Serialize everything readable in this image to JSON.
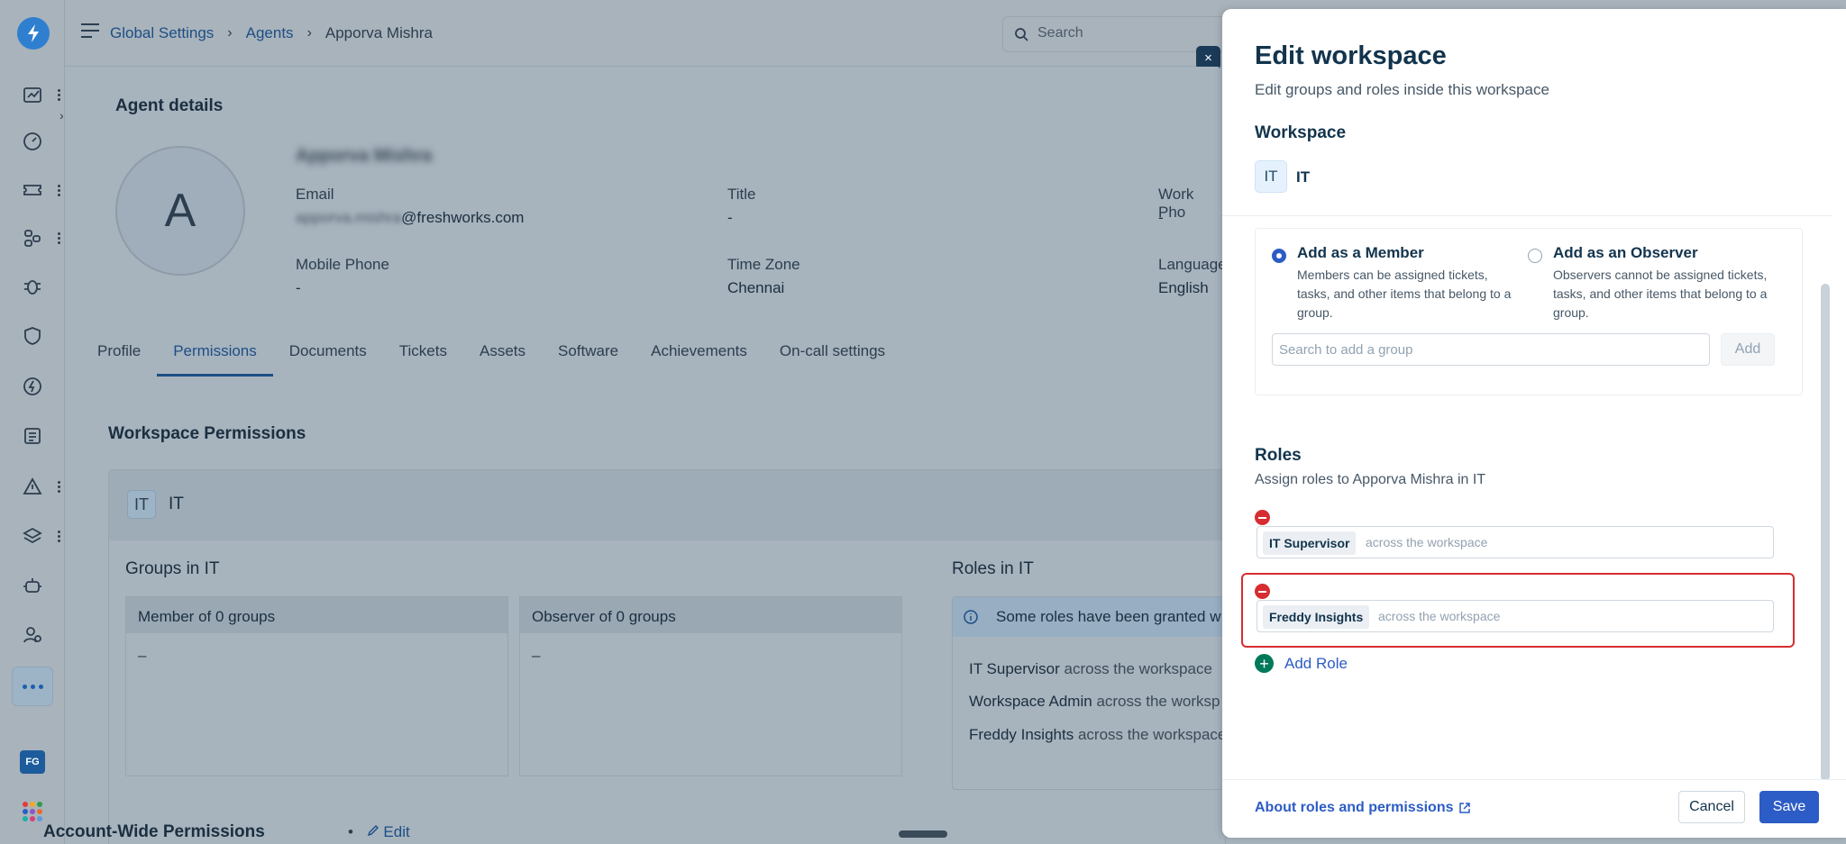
{
  "breadcrumb": {
    "items": [
      "Global Settings",
      "Agents"
    ],
    "current": "Apporva Mishra"
  },
  "search": {
    "placeholder": "Search"
  },
  "rail": {
    "user_initials": "FG",
    "apps_colors": [
      "#e33c3c",
      "#f5a623",
      "#2c9c4a",
      "#2c5cc5",
      "#8b54c7",
      "#e86d2e",
      "#1bb0a8",
      "#d8407a",
      "#5a9bd8"
    ]
  },
  "agent": {
    "section_title": "Agent details",
    "avatar_letter": "A",
    "name": "Apporva Mishra",
    "fields": {
      "email_label": "Email",
      "email_user": "apporva.mishra",
      "email_domain": "@freshworks.com",
      "title_label": "Title",
      "title_value": "-",
      "work_phone_label": "Work Pho",
      "work_phone_value": "-",
      "mobile_label": "Mobile Phone",
      "mobile_value": "-",
      "timezone_label": "Time Zone",
      "timezone_value": "Chennai",
      "language_label": "Language",
      "language_value": "English"
    }
  },
  "tabs": [
    "Profile",
    "Permissions",
    "Documents",
    "Tickets",
    "Assets",
    "Software",
    "Achievements",
    "On-call settings"
  ],
  "workspace_permissions": {
    "title": "Workspace Permissions",
    "badge": "IT",
    "name": "IT",
    "groups_title": "Groups in IT",
    "member_header": "Member of 0 groups",
    "member_value": "–",
    "observer_header": "Observer of 0 groups",
    "observer_value": "–",
    "roles_title": "Roles in IT",
    "roles_info": "Some roles have been granted w",
    "roles": [
      {
        "name": "IT Supervisor",
        "scope": "across the workspace"
      },
      {
        "name": "Workspace Admin",
        "scope": "across the worksp"
      },
      {
        "name": "Freddy Insights",
        "scope": "across the workspace"
      }
    ]
  },
  "account_wide": {
    "title": "Account-Wide Permissions",
    "edit": "Edit"
  },
  "drawer": {
    "title": "Edit workspace",
    "subtitle": "Edit groups and roles inside this workspace",
    "workspace_label": "Workspace",
    "workspace_badge": "IT",
    "workspace_name": "IT",
    "member_title": "Add as a Member",
    "member_desc": "Members can be assigned tickets, tasks, and other items that belong to a group.",
    "observer_title": "Add as an Observer",
    "observer_desc": "Observers cannot be assigned tickets, tasks, and other items that belong to a group.",
    "group_search_placeholder": "Search to add a group",
    "add_label": "Add",
    "roles_title": "Roles",
    "roles_subtitle": "Assign roles to Apporva Mishra in IT",
    "roles": [
      {
        "name": "IT Supervisor",
        "scope": "across the workspace"
      },
      {
        "name": "Freddy Insights",
        "scope": "across the workspace"
      }
    ],
    "add_role": "Add Role",
    "about_link": "About roles and permissions",
    "cancel": "Cancel",
    "save": "Save",
    "close": "×"
  },
  "colors": {
    "primary": "#2c5cc5",
    "danger": "#d72d30",
    "success": "#00795b"
  }
}
